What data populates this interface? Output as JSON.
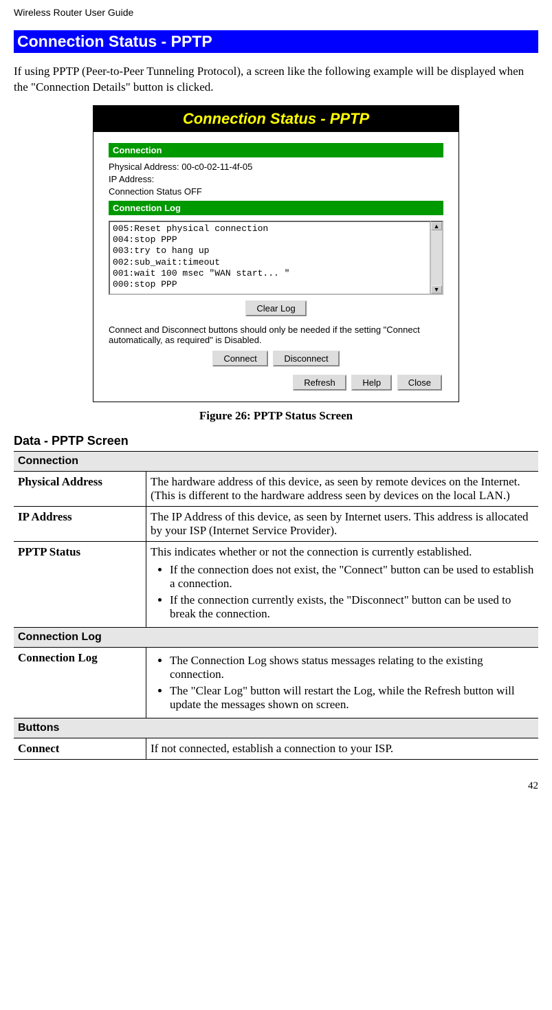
{
  "header": "Wireless Router User Guide",
  "title_bar": "Connection Status - PPTP",
  "intro": "If using PPTP (Peer-to-Peer Tunneling Protocol), a screen like the following example will be displayed when the \"Connection Details\" button is clicked.",
  "screenshot": {
    "title": "Connection Status - PPTP",
    "section1": "Connection",
    "physical_address_label": "Physical Address:",
    "physical_address_value": "00-c0-02-11-4f-05",
    "ip_address_label": "IP Address:",
    "connection_status_label": "Connection Status",
    "connection_status_value": "OFF",
    "section2": "Connection Log",
    "log_lines": [
      "005:Reset physical connection",
      "004:stop PPP",
      "003:try to hang up",
      "002:sub_wait:timeout",
      "001:wait 100 msec \"WAN start...  \"",
      "000:stop PPP"
    ],
    "clear_log_btn": "Clear Log",
    "note": "Connect and Disconnect buttons should only be needed if the setting \"Connect automatically, as required\" is Disabled.",
    "connect_btn": "Connect",
    "disconnect_btn": "Disconnect",
    "refresh_btn": "Refresh",
    "help_btn": "Help",
    "close_btn": "Close"
  },
  "caption": "Figure 26: PPTP Status Screen",
  "data_heading": "Data - PPTP Screen",
  "tbl": {
    "s1": "Connection",
    "r1l": "Physical Address",
    "r1d": "The hardware address of this device, as seen by remote devices on the Internet. (This is different to the hardware address seen by devices on the local LAN.)",
    "r2l": "IP Address",
    "r2d": "The IP Address of this device, as seen by Internet users. This address is allocated by your ISP (Internet Service Provider).",
    "r3l": "PPTP Status",
    "r3d_intro": "This indicates whether or not the connection is currently established.",
    "r3d_b1": "If the connection does not exist, the \"Connect\" button can be used to establish a connection.",
    "r3d_b2": "If the connection currently exists, the \"Disconnect\" button can be used to break the connection.",
    "s2": "Connection Log",
    "r4l": "Connection Log",
    "r4d_b1": "The Connection Log shows status messages relating to the existing connection.",
    "r4d_b2": "The \"Clear Log\" button will restart the Log, while the Refresh button will update the messages shown on screen.",
    "s3": "Buttons",
    "r5l": "Connect",
    "r5d": "If not connected, establish a connection to your ISP."
  },
  "page_number": "42"
}
